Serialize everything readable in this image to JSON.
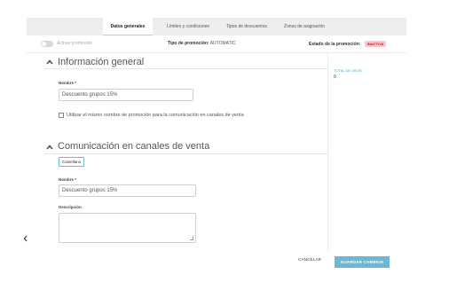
{
  "tabs": [
    {
      "label": "Datos generales"
    },
    {
      "label": "Límites y condiciones"
    },
    {
      "label": "Tipos de descuentos"
    },
    {
      "label": "Zonas de asignación"
    }
  ],
  "status": {
    "toggle_label": "Activar promoción",
    "type_label": "Tipo de promoción:",
    "type_value": "AUTOMATIC",
    "state_label": "Estado de la promoción:",
    "state_value": "INACTIVA",
    "state_color": "#c8202f"
  },
  "general_section": {
    "title": "Información general",
    "name_label": "Nombre *",
    "name_value": "Descuento grupos 15%",
    "checkbox_label": "Utilizar el mismo nombre de promoción para la comunicación en canales de venta"
  },
  "comm_section": {
    "title": "Comunicación en canales de venta",
    "language_button": "Castellano",
    "name_label": "Nombre *",
    "name_value": "Descuento grupos 15%",
    "description_label": "Descripción"
  },
  "sidebar": {
    "total_label": "TOTAL DE USOS",
    "total_value": "0"
  },
  "footer": {
    "cancel_label": "CANCELAR",
    "save_label": "GUARDAR CAMBIOS",
    "accent_color": "#6ab8d3"
  },
  "icons": {
    "back": "chevron-left-icon",
    "collapse": "chevron-up-icon"
  }
}
